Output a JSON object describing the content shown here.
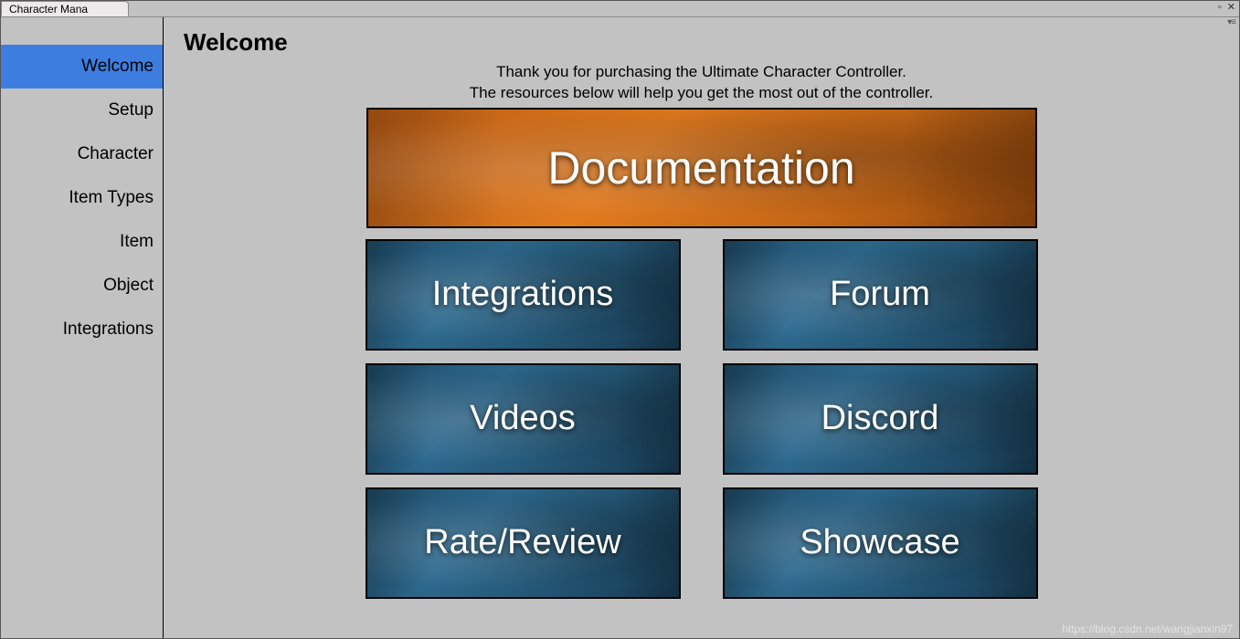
{
  "window": {
    "tab_title": "Character Mana"
  },
  "sidebar": {
    "items": [
      {
        "label": "Welcome",
        "active": true
      },
      {
        "label": "Setup",
        "active": false
      },
      {
        "label": "Character",
        "active": false
      },
      {
        "label": "Item Types",
        "active": false
      },
      {
        "label": "Item",
        "active": false
      },
      {
        "label": "Object",
        "active": false
      },
      {
        "label": "Integrations",
        "active": false
      }
    ]
  },
  "main": {
    "title": "Welcome",
    "intro_line1": "Thank you for purchasing the Ultimate Character Controller.",
    "intro_line2": "The resources below will help you get the most out of the controller.",
    "big_card": "Documentation",
    "cards": [
      "Integrations",
      "Forum",
      "Videos",
      "Discord",
      "Rate/Review",
      "Showcase"
    ]
  },
  "watermark": "https://blog.csdn.net/wangjianxin97"
}
